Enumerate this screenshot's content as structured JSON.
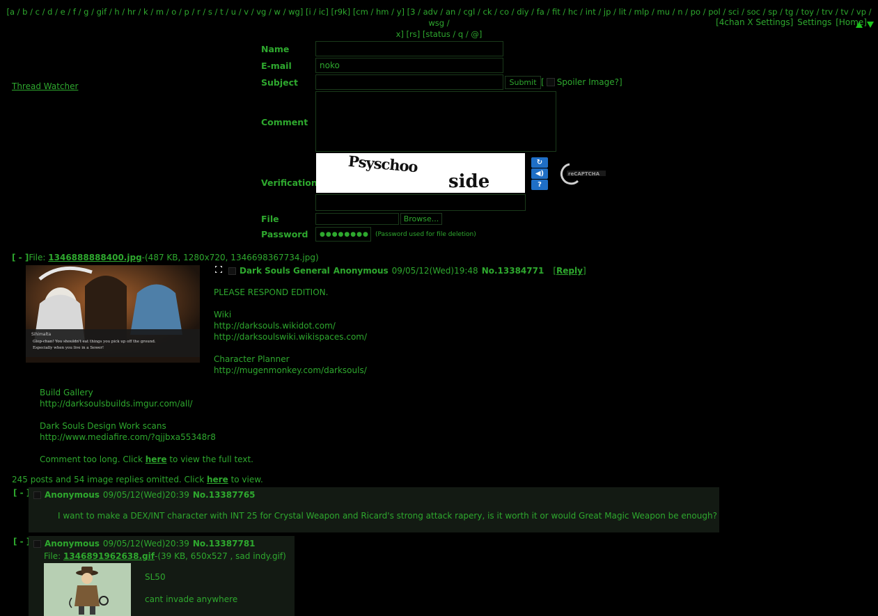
{
  "nav": {
    "line1": "[a / b / c / d / e / f / g / gif / h / hr / k / m / o / p / r / s / t / u / v / vg / w / wg] [i / ic] [r9k] [cm / hm / y] [3 / adv / an / cgl / ck / co / diy / fa / fit / hc / int / jp / lit / mlp / mu / n / po / pol / sci / soc / sp / tg / toy / trv / tv / vp / wsg /",
    "line2": "x] [rs] [status / q / @]",
    "settings_4chanx": "[4chan X Settings]",
    "settings": "Settings",
    "home": "[Home]"
  },
  "thread_watcher": "Thread Watcher",
  "form": {
    "name_label": "Name",
    "email_label": "E-mail",
    "email_value": "noko",
    "subject_label": "Subject",
    "submit_label": "Submit",
    "spoiler_open": "[",
    "spoiler_label": "Spoiler Image?]",
    "comment_label": "Comment",
    "verification_label": "Verification",
    "captcha_word1": "Psyschoo",
    "captcha_word2": "side",
    "recaptcha_brand": "reCAPTCHA",
    "file_label": "File",
    "browse_label": "Browse...",
    "password_label": "Password",
    "password_value": "●●●●●●●●",
    "password_note": "(Password used for file deletion)"
  },
  "op": {
    "toggle": "[ - ]",
    "file_prefix": "File:",
    "file_name": "1346888888400.jpg",
    "file_meta": "-(487 KB, 1280x720, 1346698367734.jpg)",
    "subject": "Dark Souls General",
    "name": "Anonymous",
    "date": "09/05/12(Wed)19:48",
    "number": "No.13384771",
    "reply_open": "[",
    "reply": "Reply",
    "reply_close": "]",
    "thumb_caption_name": "Sihimalta",
    "thumb_caption_line1": "Glop-chan! You shouldn't eat things you pick up off the ground.",
    "thumb_caption_line2": "Especially when you live in a Sewer!",
    "body_top": [
      "PLEASE RESPOND EDITION.",
      "",
      "Wiki",
      "http://darksouls.wikidot.com/",
      "http://darksoulswiki.wikispaces.com/",
      "",
      "Character Planner",
      "http://mugenmonkey.com/darksouls/"
    ],
    "body_bottom": [
      "",
      "Build Gallery",
      "http://darksoulsbuilds.imgur.com/all/",
      "",
      "Dark Souls Design Work scans",
      "http://www.mediafire.com/?qjjbxa55348r8"
    ],
    "too_long_pre": "Comment too long. Click",
    "too_long_link": "here",
    "too_long_post": "to view the full text.",
    "omitted_pre": "245 posts and 54 image replies omitted. Click",
    "omitted_link": "here",
    "omitted_post": "to view."
  },
  "replies": [
    {
      "toggle": "[ - ]",
      "name": "Anonymous",
      "date": "09/05/12(Wed)20:39",
      "number": "No.13387765",
      "text": "I want to make a DEX/INT character with INT 25 for Crystal Weapon and Ricard's strong attack rapery, is it worth it or would Great Magic Weapon be enough?"
    },
    {
      "toggle": "[ - ]",
      "name": "Anonymous",
      "date": "09/05/12(Wed)20:39",
      "number": "No.13387781",
      "file_prefix": "File:",
      "file_name": "1346891962638.gif",
      "file_meta": "-(39 KB, 650x527 , sad indy.gif)",
      "line1": "SL50",
      "line2": "cant invade anywhere"
    }
  ]
}
